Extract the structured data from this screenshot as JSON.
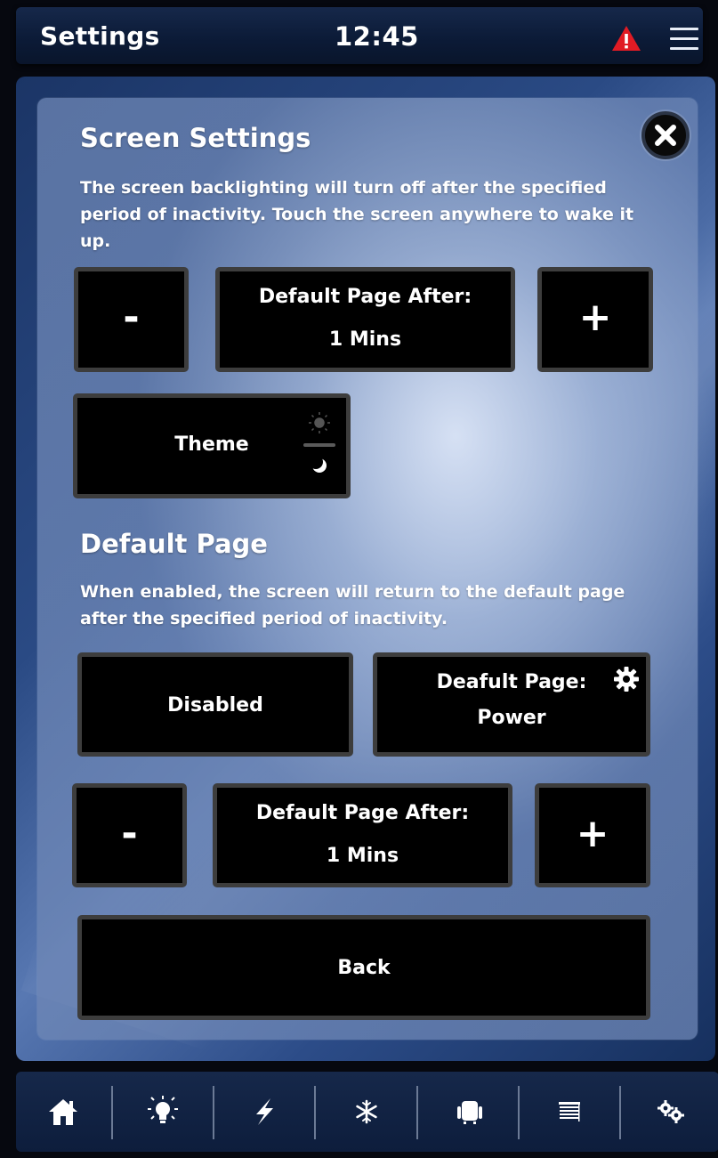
{
  "header": {
    "title": "Settings",
    "time": "12:45",
    "warning_icon": "warning-icon",
    "menu_icon": "hamburger-menu-icon"
  },
  "screen_settings": {
    "heading": "Screen Settings",
    "description": "The screen backlighting will turn off after the specified period of inactivity. Touch the screen anywhere to wake it up.",
    "decrement_label": "-",
    "increment_label": "+",
    "timeout_label": "Default Page After:",
    "timeout_value": "1 Mins",
    "theme_label": "Theme"
  },
  "default_page": {
    "heading": "Default Page",
    "description": "When enabled, the screen will return to the default page after the specified period of inactivity.",
    "toggle_label": "Disabled",
    "page_label": "Deafult Page:",
    "page_value": "Power",
    "decrement_label": "-",
    "increment_label": "+",
    "timeout_label": "Default Page After:",
    "timeout_value": "1 Mins"
  },
  "back_label": "Back",
  "footer": {
    "items": [
      "home-icon",
      "lightbulb-icon",
      "power-bolt-icon",
      "snowflake-icon",
      "seat-icon",
      "blinds-icon",
      "settings-gears-icon"
    ]
  },
  "colors": {
    "warning": "#e01b24",
    "button_bg": "#000000",
    "button_border": "#3d3d3d",
    "header_bg": "#0b1a36"
  }
}
